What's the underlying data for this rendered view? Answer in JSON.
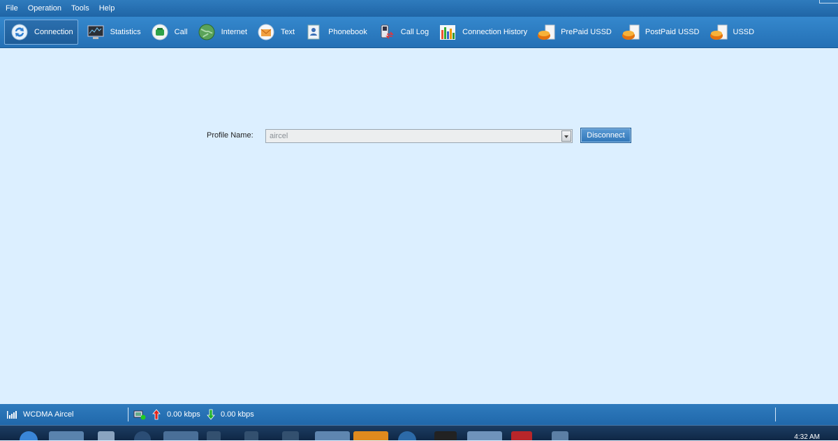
{
  "menu": {
    "items": [
      "File",
      "Operation",
      "Tools",
      "Help"
    ]
  },
  "toolbar": {
    "items": [
      {
        "label": "Connection",
        "icon": "connection-icon"
      },
      {
        "label": "Statistics",
        "icon": "statistics-icon"
      },
      {
        "label": "Call",
        "icon": "phone-icon"
      },
      {
        "label": "Internet",
        "icon": "globe-icon"
      },
      {
        "label": "Text",
        "icon": "envelope-icon"
      },
      {
        "label": "Phonebook",
        "icon": "phonebook-icon"
      },
      {
        "label": "Call Log",
        "icon": "call-log-icon"
      },
      {
        "label": "Connection History",
        "icon": "bar-chart-icon"
      },
      {
        "label": "PrePaid USSD",
        "icon": "prepaid-ussd-icon"
      },
      {
        "label": "PostPaid USSD",
        "icon": "postpaid-ussd-icon"
      },
      {
        "label": "USSD",
        "icon": "ussd-icon"
      }
    ],
    "active": "Connection"
  },
  "main": {
    "profile_label": "Profile Name:",
    "profile_value": "aircel",
    "disconnect_label": "Disconnect"
  },
  "status": {
    "network": "WCDMA",
    "operator": "Aircel",
    "upload": "0.00 kbps",
    "download": "0.00 kbps"
  },
  "taskbar": {
    "clock": "4:32 AM"
  },
  "colors": {
    "accent": "#2a74b8",
    "background": "#dcefff"
  }
}
